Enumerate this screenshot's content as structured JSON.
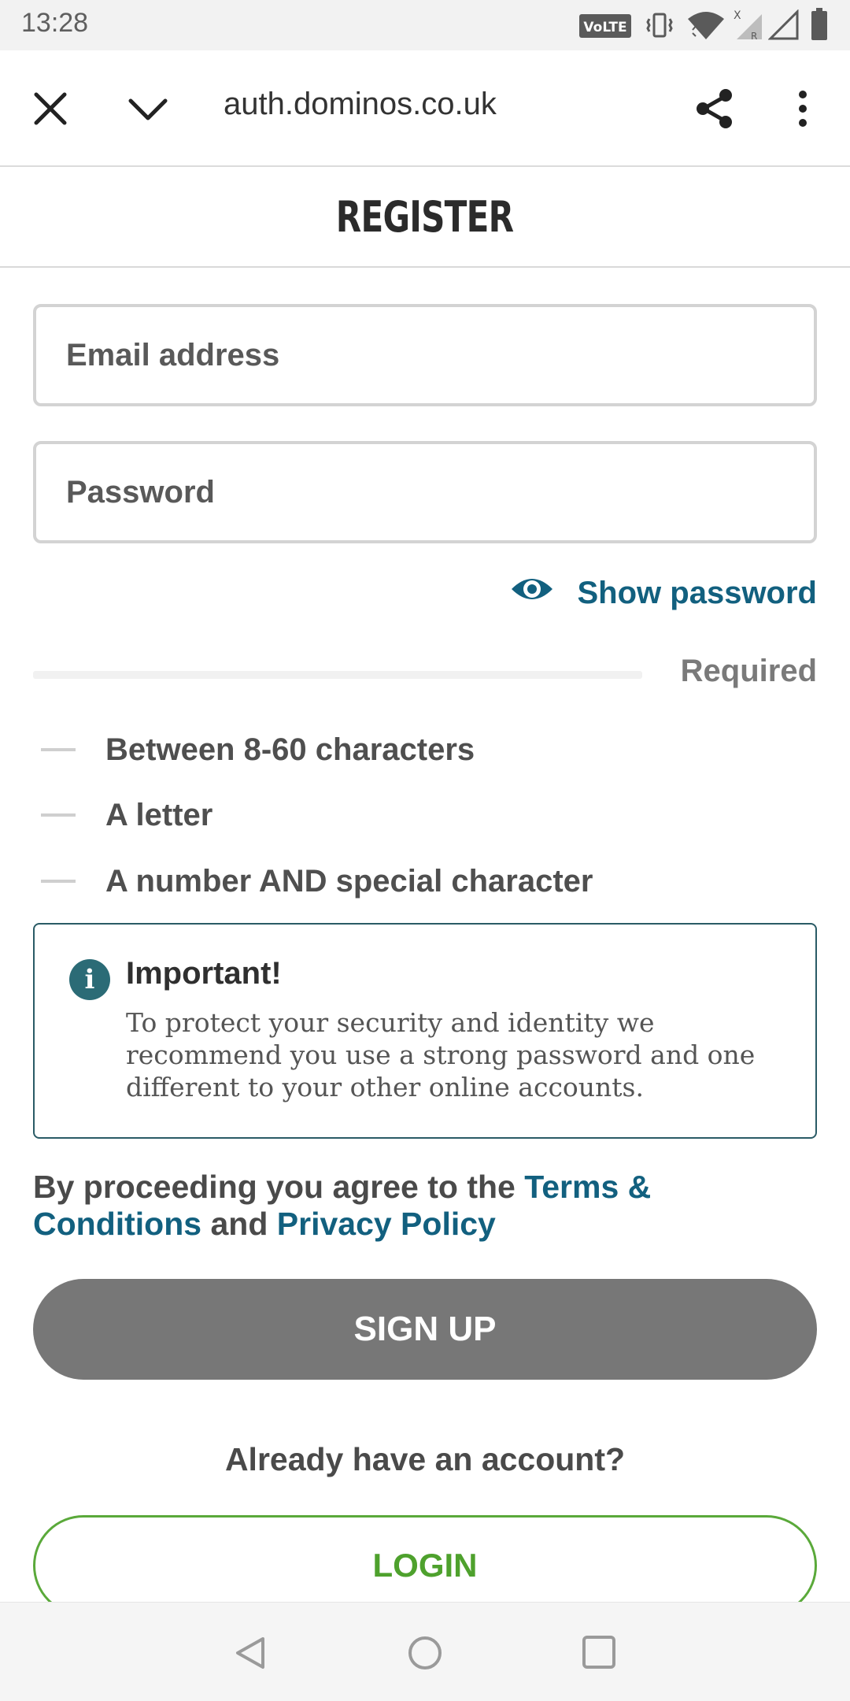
{
  "status_bar": {
    "time": "13:28",
    "volte_label": "VoLTE",
    "roaming_x": "X",
    "roaming_r": "R",
    "icons": [
      "volte-icon",
      "vibrate-icon",
      "wifi-icon",
      "signal-roaming-icon",
      "signal-icon",
      "battery-icon"
    ]
  },
  "browser": {
    "url": "auth.dominos.co.uk",
    "icons": [
      "close-icon",
      "chevron-down-icon",
      "share-icon",
      "more-vert-icon"
    ]
  },
  "page": {
    "title": "REGISTER"
  },
  "form": {
    "email_placeholder": "Email address",
    "password_placeholder": "Password",
    "show_password_label": "Show password",
    "strength_label": "Required",
    "requirements": [
      "Between 8-60 characters",
      "A letter",
      "A number AND special character"
    ]
  },
  "important": {
    "icon_glyph": "i",
    "title": "Important!",
    "text": "To protect your security and identity we recommend you use a strong password and one different to your other online accounts."
  },
  "terms": {
    "prefix": "By proceeding you agree to the ",
    "terms_link": "Terms & Conditions",
    "middle": " and ",
    "privacy_link": "Privacy Policy"
  },
  "actions": {
    "signup_label": "SIGN UP",
    "have_account": "Already have an account?",
    "login_label": "LOGIN"
  },
  "colors": {
    "link": "#12607f",
    "signup_bg": "#777777",
    "login_green": "#4ea12d",
    "info_teal": "#2b6b76"
  }
}
